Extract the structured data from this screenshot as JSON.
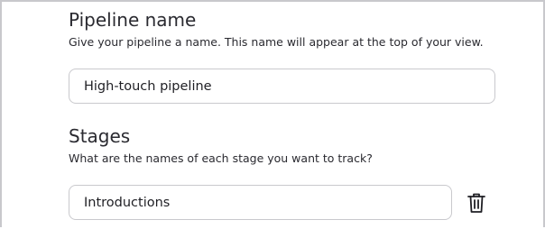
{
  "pipeline_name": {
    "title": "Pipeline name",
    "description": "Give your pipeline a name. This name will appear at the top of your view.",
    "value": "High-touch pipeline"
  },
  "stages": {
    "title": "Stages",
    "description": "What are the names of each stage you want to track?",
    "items": [
      {
        "value": "Introductions",
        "delete_icon": "trash-icon"
      }
    ]
  }
}
